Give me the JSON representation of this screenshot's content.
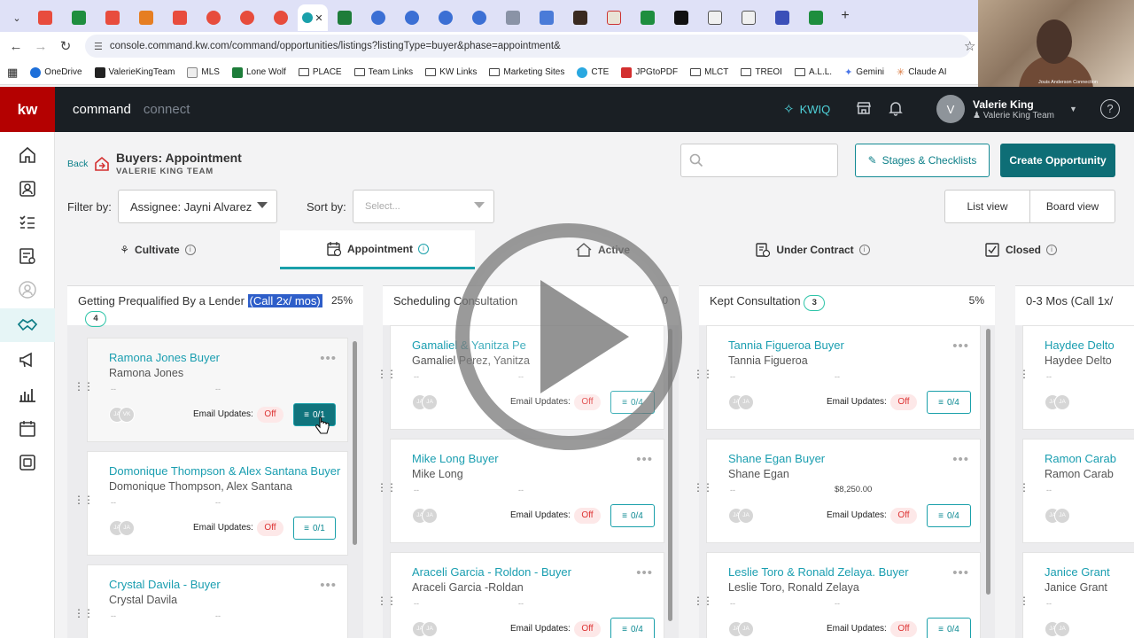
{
  "browser": {
    "url": "console.command.kw.com/command/opportunities/listings?listingType=buyer&phase=appointment&",
    "bookmarks": [
      "OneDrive",
      "ValerieKingTeam",
      "MLS",
      "Lone Wolf",
      "PLACE",
      "Team Links",
      "KW Links",
      "Marketing Sites",
      "CTE",
      "JPGtoPDF",
      "MLCT",
      "TREOI",
      "A.L.L.",
      "Gemini",
      "Claude AI"
    ]
  },
  "webcam": {
    "caption": "Jouis Anderson Connection"
  },
  "app": {
    "logo": "kw",
    "name": "command",
    "section": "connect",
    "kwiq": "KWIQ",
    "user_initial": "V",
    "user_name": "Valerie King",
    "user_team": "Valerie King Team"
  },
  "page": {
    "back": "Back",
    "title": "Buyers: Appointment",
    "subtitle": "VALERIE KING TEAM",
    "stages_btn": "Stages & Checklists",
    "create_btn": "Create Opportunity",
    "filter_label": "Filter by:",
    "filter_value": "Assignee: Jayni Alvarez",
    "sort_label": "Sort by:",
    "sort_placeholder": "Select...",
    "list_view": "List view",
    "board_view": "Board view"
  },
  "stages": [
    "Cultivate",
    "Appointment",
    "Active",
    "Under Contract",
    "Closed"
  ],
  "columns": [
    {
      "title": "Getting Prequalified By a Lender",
      "highlight": "(Call 2x/ mos)",
      "pct": "25%",
      "count": "4",
      "cards": [
        {
          "name": "Ramona Jones Buyer",
          "person": "Ramona Jones",
          "d1": "--",
          "d2": "--",
          "av": [
            "JA",
            "VK"
          ],
          "eu": "Email Updates:",
          "off": "Off",
          "chk": "0/1"
        },
        {
          "name": "Domonique Thompson & Alex Santana Buyer",
          "person": "Domonique Thompson, Alex Santana",
          "d1": "--",
          "d2": "--",
          "av": [
            "JA",
            "JA"
          ],
          "eu": "Email Updates:",
          "off": "Off",
          "chk": "0/1"
        },
        {
          "name": "Crystal Davila - Buyer",
          "person": "Crystal Davila",
          "d1": "--",
          "d2": "--"
        }
      ]
    },
    {
      "title": "Scheduling Consultation",
      "pct": "0",
      "cards": [
        {
          "name": "Gamaliel & Yanitza Pe",
          "person": "Gamaliel Perez, Yanitza",
          "d1": "--",
          "d2": "--",
          "av": [
            "JA",
            "JA"
          ],
          "eu": "Email Updates:",
          "off": "Off",
          "chk": "0/4"
        },
        {
          "name": "Mike Long Buyer",
          "person": "Mike Long",
          "d1": "--",
          "d2": "--",
          "av": [
            "JA",
            "JA"
          ],
          "eu": "Email Updates:",
          "off": "Off",
          "chk": "0/4"
        },
        {
          "name": "Araceli Garcia - Roldon - Buyer",
          "person": "Araceli Garcia -Roldan",
          "d1": "--",
          "d2": "--",
          "av": [
            "JA",
            "JA"
          ],
          "eu": "Email Updates:",
          "off": "Off",
          "chk": "0/4"
        }
      ]
    },
    {
      "title": "Kept Consultation",
      "pct": "5%",
      "count": "3",
      "cards": [
        {
          "name": "Tannia Figueroa Buyer",
          "person": "Tannia Figueroa",
          "d1": "--",
          "d2": "--",
          "av": [
            "JA",
            "JA"
          ],
          "eu": "Email Updates:",
          "off": "Off",
          "chk": "0/4"
        },
        {
          "name": "Shane Egan Buyer",
          "person": "Shane Egan",
          "d1": "--",
          "amount": "$8,250.00",
          "av": [
            "JA",
            "JA"
          ],
          "eu": "Email Updates:",
          "off": "Off",
          "chk": "0/4"
        },
        {
          "name": "Leslie Toro & Ronald Zelaya. Buyer",
          "person": "Leslie Toro, Ronald Zelaya",
          "d1": "--",
          "d2": "--",
          "av": [
            "JA",
            "JA"
          ],
          "eu": "Email Updates:",
          "off": "Off",
          "chk": "0/4"
        }
      ]
    },
    {
      "title": "0-3 Mos (Call 1x/",
      "cards": [
        {
          "name": "Haydee Delto",
          "person": "Haydee Delto",
          "d1": "--",
          "av": [
            "JA",
            "JA"
          ]
        },
        {
          "name": "Ramon Carab",
          "person": "Ramon Carab",
          "d1": "--",
          "av": [
            "JA",
            "JA"
          ]
        },
        {
          "name": "Janice Grant",
          "person": "Janice Grant",
          "d1": "--",
          "av": [
            "JA",
            "JA"
          ]
        }
      ]
    }
  ]
}
